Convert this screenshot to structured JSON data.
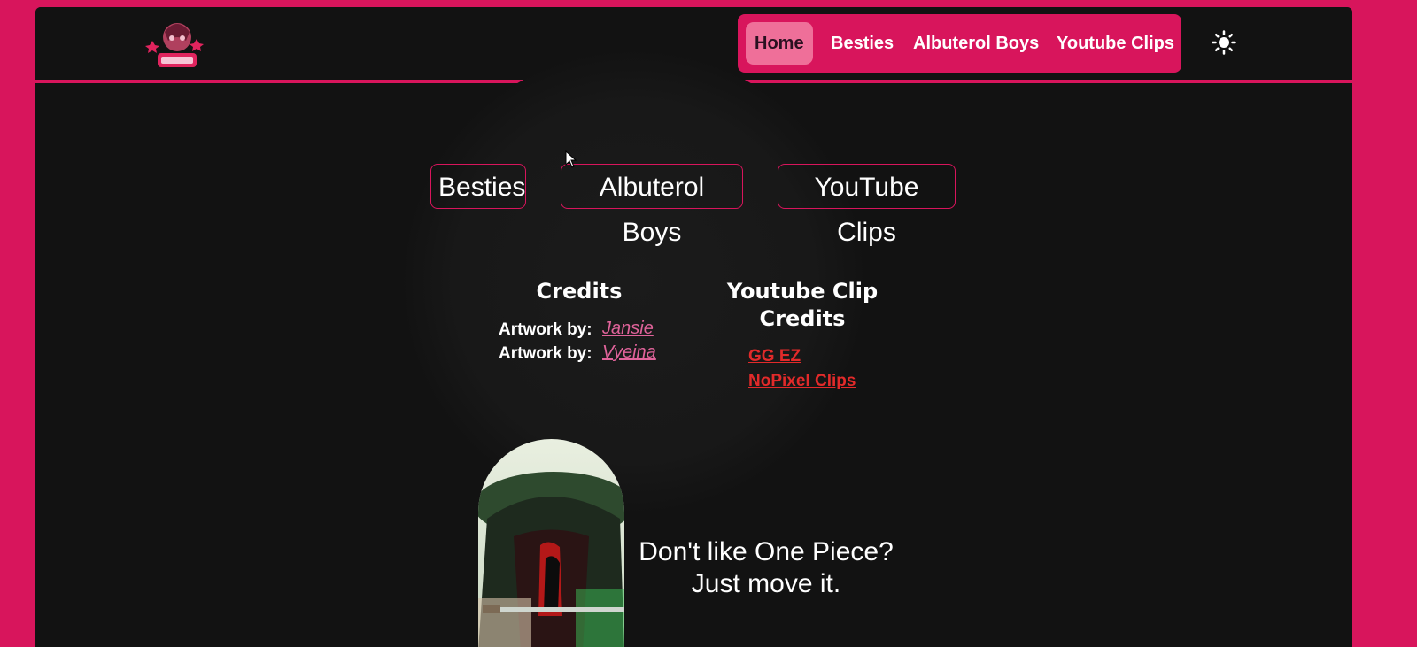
{
  "nav": {
    "items": [
      {
        "label": "Home",
        "active": true
      },
      {
        "label": "Besties",
        "active": false
      },
      {
        "label": "Albuterol Boys",
        "active": false
      },
      {
        "label": "Youtube Clips",
        "active": false
      }
    ],
    "theme_toggle_icon": "sun-icon",
    "logo_icon": "besties-logo-icon"
  },
  "buttons": {
    "besties": "Besties",
    "albuterol_boys": "Albuterol Boys",
    "youtube_clips": "YouTube Clips"
  },
  "credits": {
    "title": "Credits",
    "rows": [
      {
        "label": "Artwork by:",
        "name": "Jansie"
      },
      {
        "label": "Artwork by:",
        "name": "Vyeina"
      }
    ]
  },
  "youtube_credits": {
    "title_line1": "Youtube Clip",
    "title_line2": "Credits",
    "links": [
      "GG EZ",
      "NoPixel Clips"
    ]
  },
  "promo": {
    "line1": "Don't like One Piece?",
    "line2": "Just move it."
  },
  "colors": {
    "accent": "#d8155c",
    "background": "#121212",
    "active_pill": "#ef6f99",
    "credit_link": "#e0639a",
    "youtube_link": "#e22a2a"
  }
}
